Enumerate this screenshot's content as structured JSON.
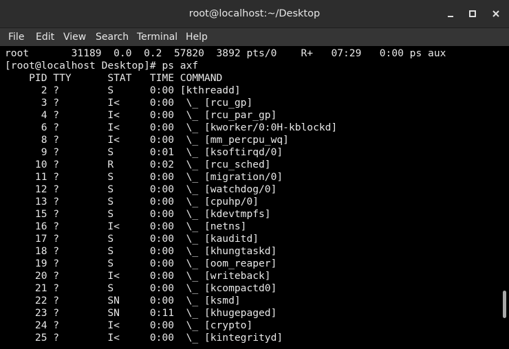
{
  "window": {
    "title": "root@localhost:~/Desktop",
    "minimize_symbol": "–",
    "close_symbol": "✕"
  },
  "menubar": {
    "items": [
      "File",
      "Edit",
      "View",
      "Search",
      "Terminal",
      "Help"
    ]
  },
  "terminal": {
    "lines": [
      "root       31189  0.0  0.2  57820  3892 pts/0    R+   07:29   0:00 ps aux",
      "[root@localhost Desktop]# ps axf",
      "    PID TTY      STAT   TIME COMMAND",
      "      2 ?        S      0:00 [kthreadd]",
      "      3 ?        I<     0:00  \\_ [rcu_gp]",
      "      4 ?        I<     0:00  \\_ [rcu_par_gp]",
      "      6 ?        I<     0:00  \\_ [kworker/0:0H-kblockd]",
      "      8 ?        I<     0:00  \\_ [mm_percpu_wq]",
      "      9 ?        S      0:01  \\_ [ksoftirqd/0]",
      "     10 ?        R      0:02  \\_ [rcu_sched]",
      "     11 ?        S      0:00  \\_ [migration/0]",
      "     12 ?        S      0:00  \\_ [watchdog/0]",
      "     13 ?        S      0:00  \\_ [cpuhp/0]",
      "     15 ?        S      0:00  \\_ [kdevtmpfs]",
      "     16 ?        I<     0:00  \\_ [netns]",
      "     17 ?        S      0:00  \\_ [kauditd]",
      "     18 ?        S      0:00  \\_ [khungtaskd]",
      "     19 ?        S      0:00  \\_ [oom_reaper]",
      "     20 ?        I<     0:00  \\_ [writeback]",
      "     21 ?        S      0:00  \\_ [kcompactd0]",
      "     22 ?        SN     0:00  \\_ [ksmd]",
      "     23 ?        SN     0:11  \\_ [khugepaged]",
      "     24 ?        I<     0:00  \\_ [crypto]",
      "     25 ?        I<     0:00  \\_ [kintegrityd]"
    ]
  }
}
